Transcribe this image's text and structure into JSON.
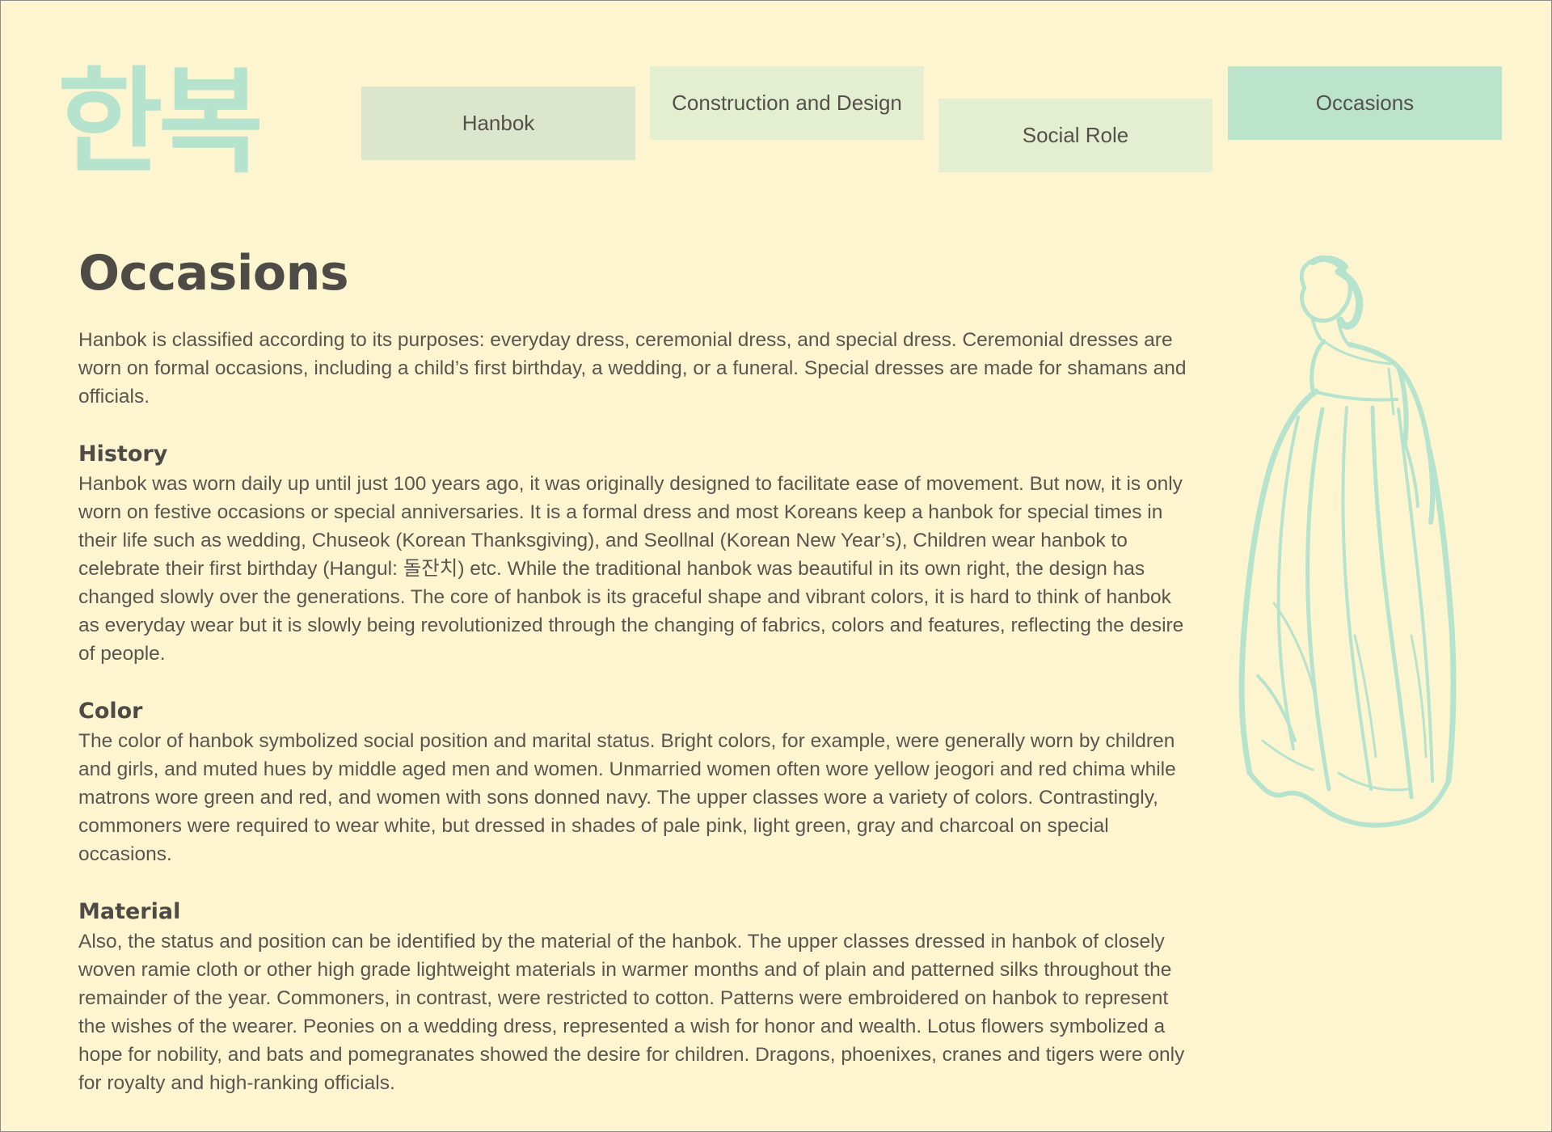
{
  "logo": {
    "text": "한복"
  },
  "nav": {
    "tabs": [
      {
        "label": "Hanbok"
      },
      {
        "label": "Construction and Design"
      },
      {
        "label": "Social Role"
      },
      {
        "label": "Occasions"
      }
    ],
    "active": "Occasions"
  },
  "main": {
    "title": "Occasions",
    "intro": "Hanbok is classified according to its purposes: everyday dress, ceremonial dress, and special dress. Ceremonial dresses are worn on formal occasions, including a child’s first birthday, a wedding, or a funeral. Special dresses are made for shamans and officials.",
    "sections": [
      {
        "heading": "History",
        "body": "Hanbok was worn daily up until just 100 years ago, it was originally designed to facilitate ease of movement. But now, it is only worn on festive occasions or special anniversaries. It is a formal dress and most Koreans keep a hanbok for special times in their life such as wedding, Chuseok (Korean Thanksgiving), and Seollnal (Korean New Year’s), Children wear hanbok to celebrate their first birthday (Hangul: 돌잔치) etc. While the traditional hanbok was beautiful in its own right, the design has changed slowly over the generations. The core of hanbok is its graceful shape and vibrant colors, it is hard to think of hanbok as everyday wear but it is slowly being revolutionized through the changing of fabrics, colors and features, reflecting the desire of people."
      },
      {
        "heading": "Color",
        "body": "The color of hanbok symbolized social position and marital status. Bright colors, for example, were generally worn by children and girls, and muted hues by middle aged men and women. Unmarried women often wore yellow jeogori and red chima while matrons wore green and red, and women with sons donned navy. The upper classes wore a variety of colors. Contrastingly, commoners were required to wear white, but dressed in shades of pale pink, light green, gray and charcoal on special occasions."
      },
      {
        "heading": "Material",
        "body": "Also, the status and position can be identified by the material of the hanbok. The upper classes dressed in hanbok of closely woven ramie cloth or other high grade lightweight materials in warmer months and of plain and patterned silks throughout the remainder of the year. Commoners, in contrast, were restricted to cotton. Patterns were embroidered on hanbok to represent the wishes of the wearer. Peonies on a wedding dress, represented a wish for honor and wealth. Lotus flowers symbolized a hope for nobility, and bats and pomegranates showed the desire for children. Dragons, phoenixes, cranes and tigers were only for royalty and high-ranking officials."
      }
    ]
  },
  "colors": {
    "background": "#fdf5d0",
    "accent_mint": "#b6e3ce",
    "tab_hanbok": "#dbe6cc",
    "tab_inactive": "#e4efd2",
    "tab_active": "#bce3cc",
    "text": "#555049"
  },
  "illustration": {
    "icon": "hanbok-woman-illustration"
  }
}
